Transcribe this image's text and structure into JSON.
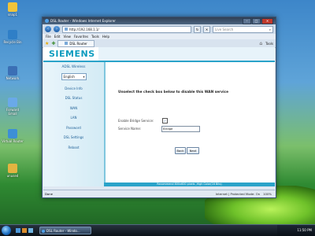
{
  "desktop": {
    "icons": [
      {
        "label": "snap1",
        "color": "#f0c43a"
      },
      {
        "label": "Recycle Bin",
        "color": "#2f7fc7"
      },
      {
        "label": "Network",
        "color": "#3b6fb5"
      },
      {
        "label": "Forward Email",
        "color": "#6aa9e8"
      },
      {
        "label": "Virtual Router",
        "color": "#3d8fd6"
      },
      {
        "label": "unused",
        "color": "#e3b441"
      }
    ]
  },
  "browser": {
    "title": "DSL Router - Windows Internet Explorer",
    "address": "http://192.168.1.1/",
    "search_placeholder": "Live Search",
    "menu": [
      "File",
      "Edit",
      "View",
      "Favorites",
      "Tools",
      "Help"
    ],
    "tab_label": "DSL Router",
    "tools_label": "Tools",
    "status_left": "Done",
    "status_zone": "Internet | Protected Mode: On",
    "zoom": "100%"
  },
  "router": {
    "logo": "SIEMENS",
    "nav_title": "ADSL Wireless",
    "language": "English",
    "nav_items": [
      "Device Info",
      "DSL Status",
      "WAN",
      "LAN",
      "Password",
      "DSL Settings",
      "Reboot"
    ],
    "header": "Unselect the check box below to disable this WAN service",
    "enable_bridge_label": "Enable Bridge Service:",
    "enable_bridge_checked": true,
    "service_name_label": "Service Name:",
    "service_name_value": "Bridge",
    "back_label": "Back",
    "next_label": "Next",
    "footer": "Recommend 800x600 pixels ,High Color(16 Bits)"
  },
  "taskbar": {
    "window_label": "DSL Router - Windo...",
    "time": "11:50 PM"
  }
}
